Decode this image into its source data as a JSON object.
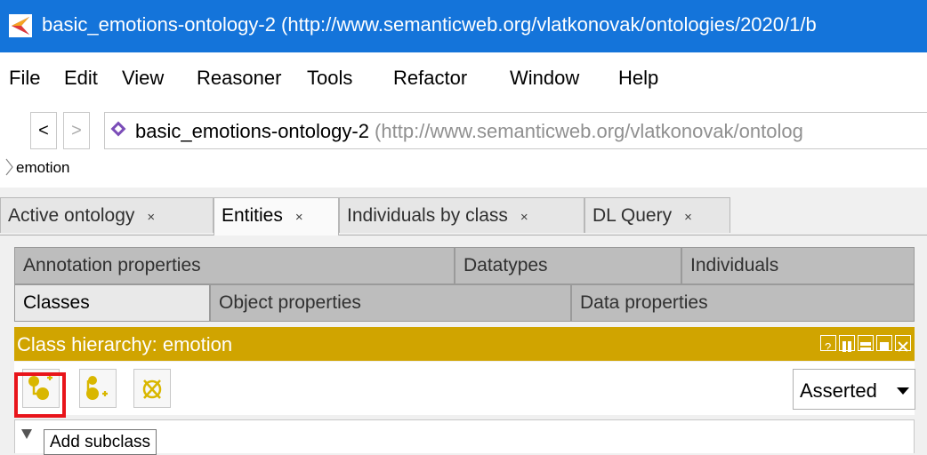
{
  "window": {
    "title": "basic_emotions-ontology-2 (http://www.semanticweb.org/vlatkonovak/ontologies/2020/1/b"
  },
  "menu": [
    "File",
    "Edit",
    "View",
    "Reasoner",
    "Tools",
    "Refactor",
    "Window",
    "Help"
  ],
  "nav": {
    "back_label": "<",
    "forward_label": ">",
    "ontology_name": "basic_emotions-ontology-2",
    "ontology_iri": " (http://www.semanticweb.org/vlatkonovak/ontolog",
    "breadcrumb": "emotion"
  },
  "tabs": [
    {
      "label": "Active ontology",
      "close": "×",
      "active": false
    },
    {
      "label": "Entities",
      "close": "×",
      "active": true
    },
    {
      "label": "Individuals by class",
      "close": "×",
      "active": false
    },
    {
      "label": "DL Query",
      "close": "×",
      "active": false
    }
  ],
  "subtabs": {
    "row1": [
      "Annotation properties",
      "Datatypes",
      "Individuals"
    ],
    "row2": [
      "Classes",
      "Object properties",
      "Data properties"
    ],
    "active": "Classes"
  },
  "view": {
    "title": "Class hierarchy: emotion",
    "mode": "Asserted"
  },
  "tooltip": "Add subclass",
  "colors": {
    "titlebar": "#1474da",
    "view_header": "#d0a400",
    "class_icon": "#d9b700",
    "highlight": "#e8141a"
  }
}
